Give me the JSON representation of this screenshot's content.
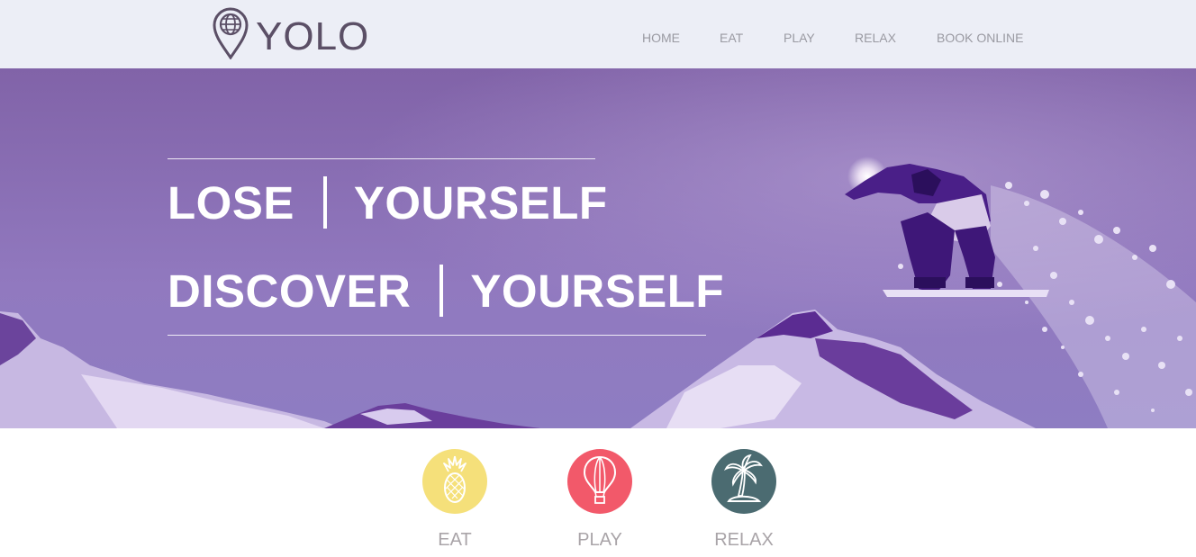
{
  "brand": {
    "name": "YOLO",
    "icon": "map-pin-globe-icon"
  },
  "nav": {
    "items": [
      {
        "label": "HOME"
      },
      {
        "label": "EAT"
      },
      {
        "label": "PLAY"
      },
      {
        "label": "RELAX"
      },
      {
        "label": "BOOK ONLINE"
      }
    ]
  },
  "hero": {
    "line1": {
      "left": "LOSE",
      "right": "YOURSELF"
    },
    "line2": {
      "left": "DISCOVER",
      "right": "YOURSELF"
    },
    "image": "snowboarder-jump-image"
  },
  "features": [
    {
      "label": "EAT",
      "icon": "pineapple-icon",
      "color": "#f5e07a"
    },
    {
      "label": "PLAY",
      "icon": "hot-air-balloon-icon",
      "color": "#f2596a"
    },
    {
      "label": "RELAX",
      "icon": "palm-tree-island-icon",
      "color": "#4b6b71"
    }
  ],
  "colors": {
    "header_bg": "#eceef6",
    "hero_tint": "#8f76bd",
    "brand_text": "#5b4f66"
  }
}
